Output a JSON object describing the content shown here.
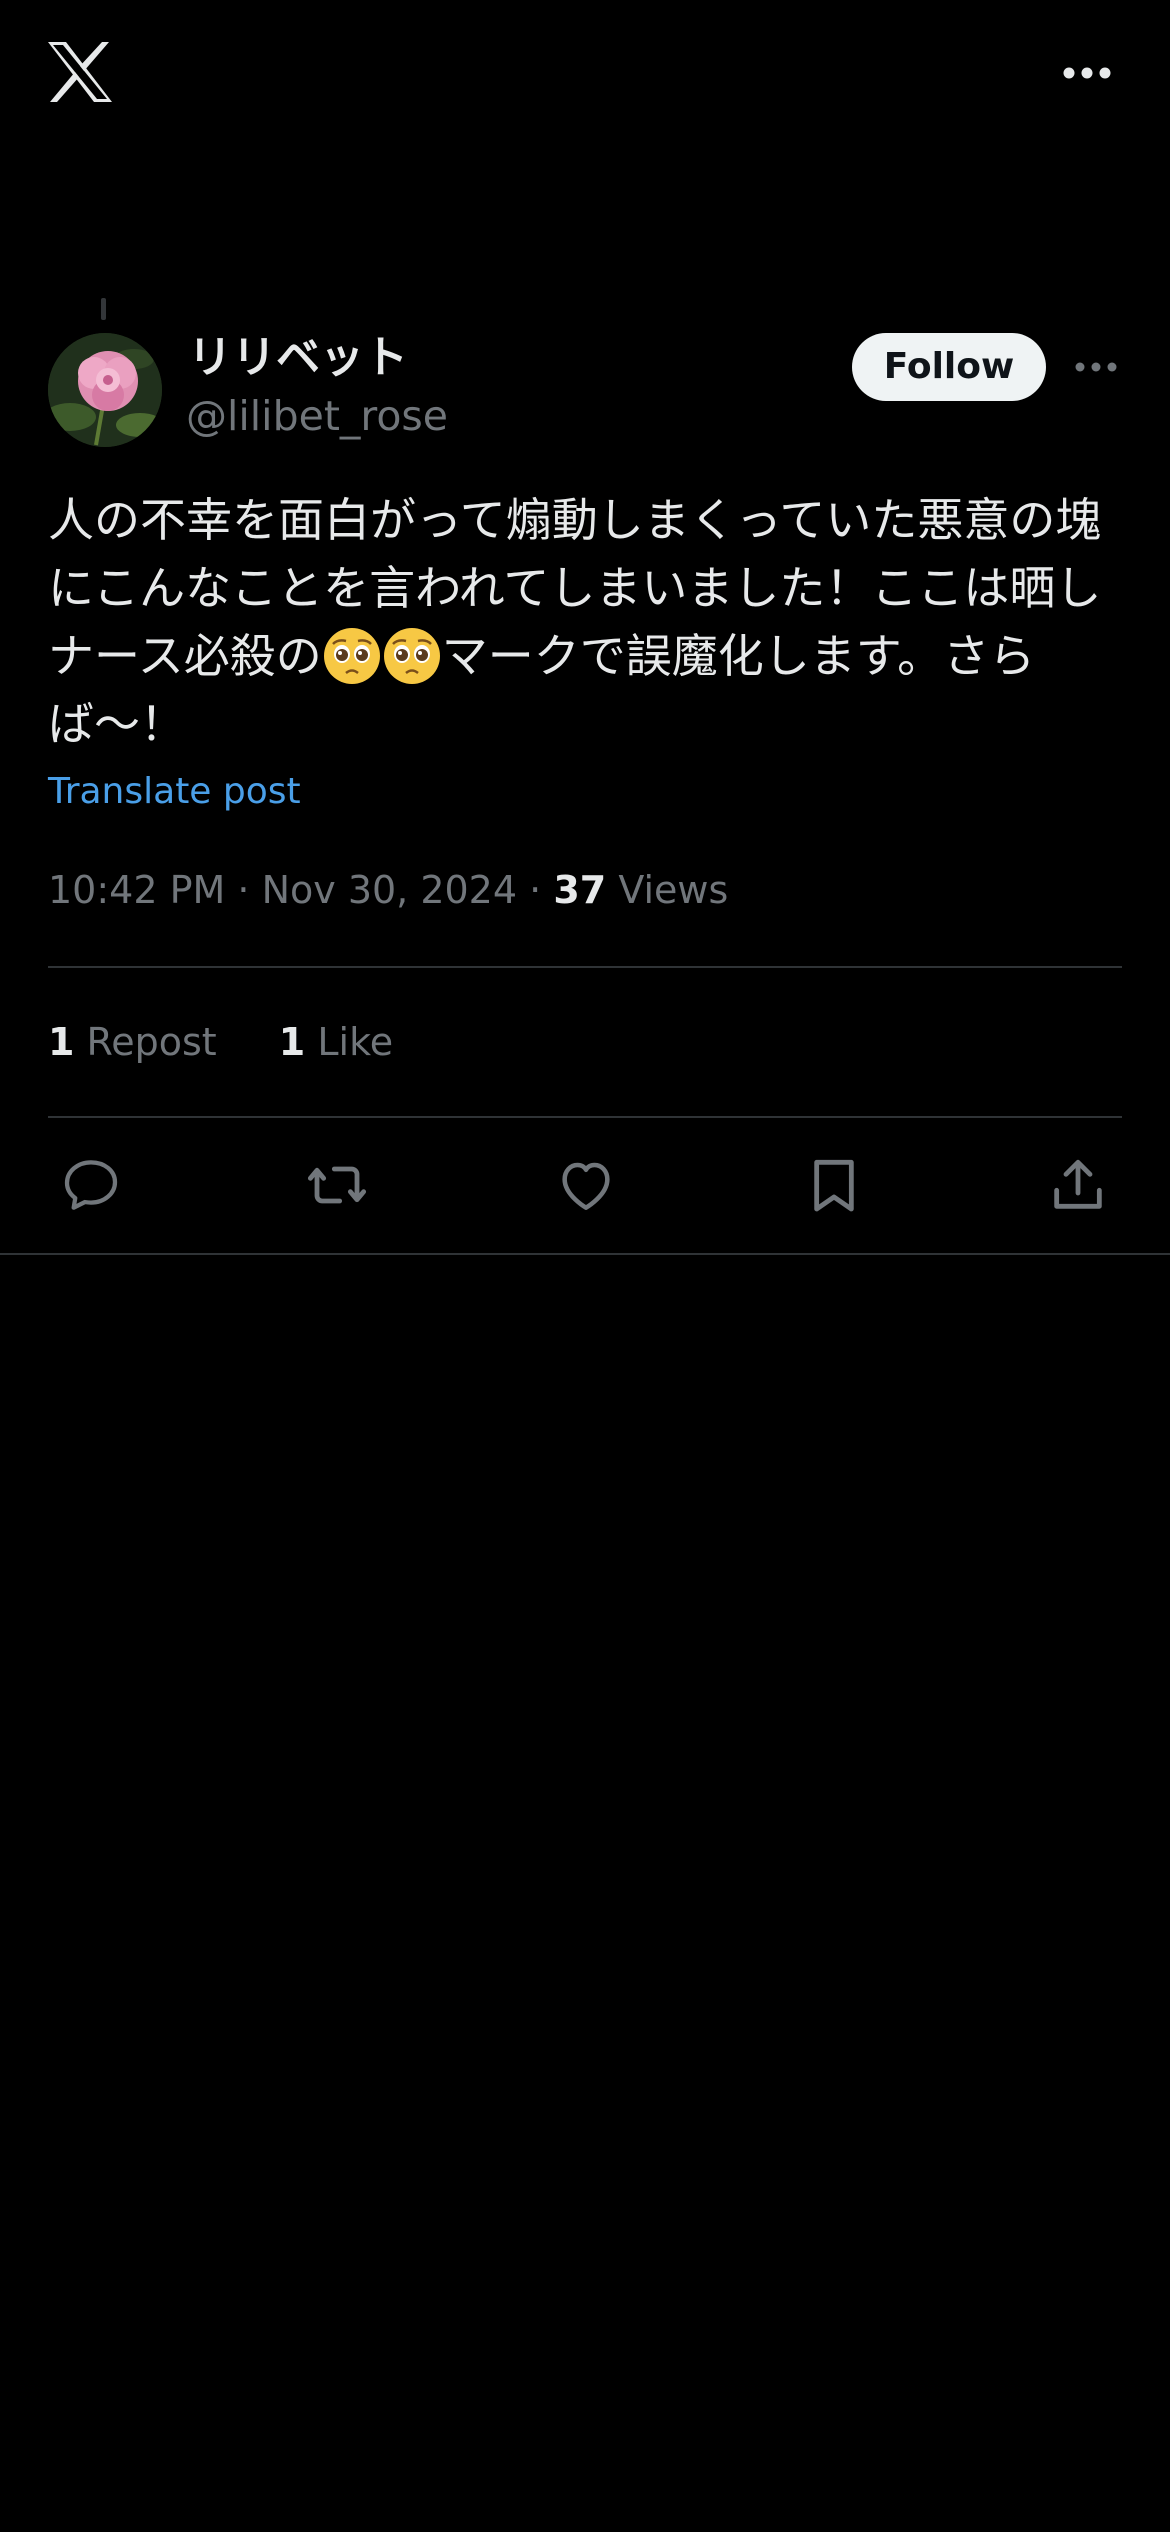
{
  "header": {
    "logo_icon": "x-logo-icon",
    "more_icon": "more-horizontal-icon"
  },
  "post": {
    "author": {
      "display_name": "リリベット",
      "handle": "@lilibet_rose",
      "avatar": "pink-rose-avatar"
    },
    "follow_label": "Follow",
    "text_part1": "人の不幸を面白がって煽動しまくっていた悪意の塊にこんなことを言われてしまいました！ここは晒しナース必殺の",
    "emoji": "pleading-face-emoji",
    "text_part2": "マークで誤魔化します。さらば〜！",
    "translate_label": "Translate post",
    "time": "10:42 PM",
    "date": "Nov 30, 2024",
    "separator": "·",
    "views_count": "37",
    "views_label": "Views",
    "reposts_count": "1",
    "reposts_label": "Repost",
    "likes_count": "1",
    "likes_label": "Like"
  },
  "actions": {
    "reply": "reply-icon",
    "repost": "repost-icon",
    "like": "like-icon",
    "bookmark": "bookmark-icon",
    "share": "share-icon"
  },
  "colors": {
    "background": "#000000",
    "text_primary": "#e7e9ea",
    "text_secondary": "#71767b",
    "link": "#4a9fe8",
    "divider": "#2f3336",
    "follow_bg": "#eff3f4"
  }
}
